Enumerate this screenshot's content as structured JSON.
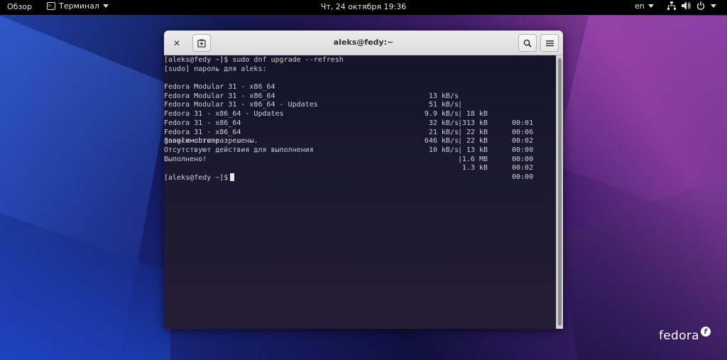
{
  "topbar": {
    "activities_label": "Обзор",
    "app_name": "Терминал",
    "app_icon_glyph": ">_",
    "clock": "Чт, 24 октября  19:36",
    "language": "en"
  },
  "window": {
    "title": "aleks@fedy:~"
  },
  "terminal": {
    "lines": [
      "[aleks@fedy ~]$ sudo dnf upgrade --refresh",
      "[sudo] пароль для aleks:"
    ],
    "repos": [
      {
        "name": "Fedora Modular 31 - x86_64",
        "speed": "13 kB/s",
        "size": "18 kB",
        "time": "00:01"
      },
      {
        "name": "Fedora Modular 31 - x86_64",
        "speed": "51 kB/s",
        "size": "313 kB",
        "time": "00:06"
      },
      {
        "name": "Fedora Modular 31 - x86_64 - Updates",
        "speed": "9.9 kB/s",
        "size": "22 kB",
        "time": "00:02"
      },
      {
        "name": "Fedora 31 - x86_64 - Updates",
        "speed": "32 kB/s",
        "size": "22 kB",
        "time": "00:00"
      },
      {
        "name": "Fedora 31 - x86_64",
        "speed": "21 kB/s",
        "size": "13 kB",
        "time": "00:00"
      },
      {
        "name": "Fedora 31 - x86_64",
        "speed": "646 kB/s",
        "size": "1.6 MB",
        "time": "00:02"
      },
      {
        "name": "google-chrome",
        "speed": "10 kB/s",
        "size": "1.3 kB",
        "time": "00:00"
      }
    ],
    "after": [
      "Зависимости разрешены.",
      "Отсутствуют действия для выполнения",
      "Выполнено!"
    ],
    "prompt": "[aleks@fedy ~]$"
  },
  "branding": {
    "logo_text": "fedora",
    "logo_mark": "f"
  },
  "colors": {
    "terminal_bg": "#1d1b30",
    "terminal_fg": "#d0d0d0",
    "topbar_bg": "#000000"
  }
}
